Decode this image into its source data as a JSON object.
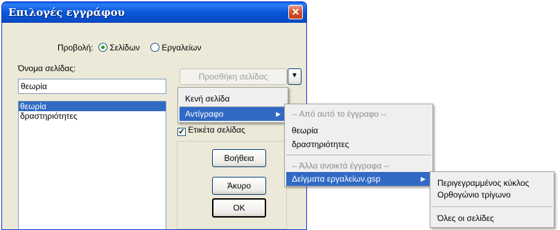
{
  "dialog": {
    "title": "Επιλογές εγγράφου",
    "view_label": "Προβολή:",
    "view_options": [
      "Σελίδων",
      "Εργαλείων"
    ],
    "page_name_label": "Όνομα σελίδας:",
    "page_name_value": "θεωρία",
    "pages_list": [
      "θεωρία",
      "δραστηριότητες"
    ],
    "add_page_button": "Προσθήκη σελίδας",
    "page_tab_checkbox": "Ετικέτα σελίδας",
    "help_button": "Βοήθεια",
    "cancel_button": "Άκυρο",
    "ok_button": "OK"
  },
  "menu1": {
    "items": [
      "Κενή σελίδα",
      "Αντίγραφο"
    ]
  },
  "menu2": {
    "header1": "-- Από αυτό το έγγραφο --",
    "items1": [
      "θεωρία",
      "δραστηριότητες"
    ],
    "header2": "-- Άλλα ανοικτά έγγραφα --",
    "items2": [
      "Δείγματα εργαλείων.gsp"
    ]
  },
  "menu3": {
    "items": [
      "Περιγεγραμμένος κύκλος",
      "Ορθογώνιο τρίγωνο"
    ],
    "all_pages": "Όλες οι σελίδες"
  },
  "colors": {
    "title_bar": "#0b56d8",
    "selection": "#316ac5",
    "dialog_bg": "#ece9d8",
    "close_button": "#d4562c"
  },
  "icons": {
    "close": "close-icon",
    "dropdown": "dropdown-arrow-icon",
    "submenu": "submenu-arrow-icon"
  }
}
